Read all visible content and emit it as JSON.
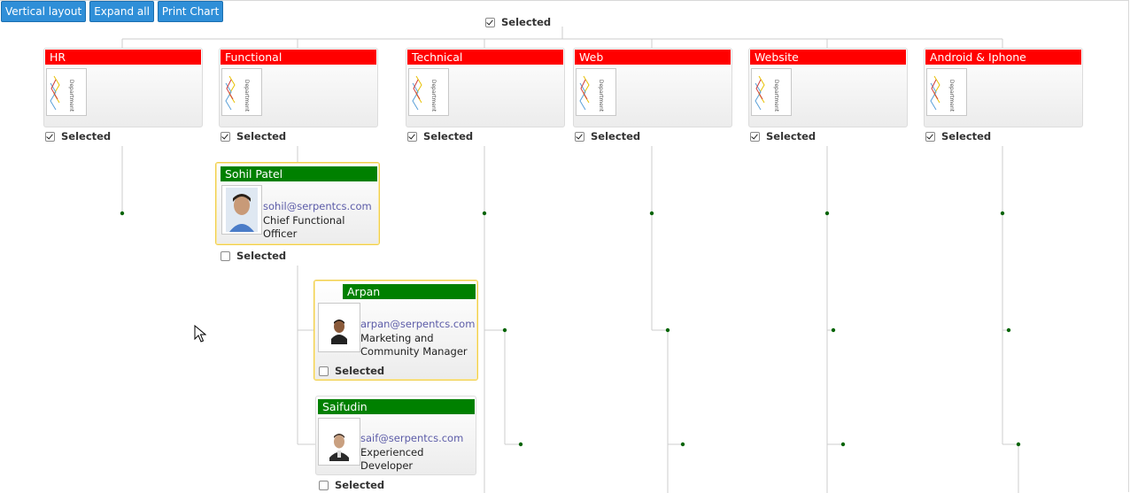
{
  "toolbar": {
    "vertical_layout_label": "Vertical layout",
    "expand_all_label": "Expand all",
    "print_chart_label": "Print Chart"
  },
  "root": {
    "selected_label": "Selected",
    "checked": true
  },
  "departments": [
    {
      "name": "HR",
      "image_text": "Department",
      "selected_label": "Selected",
      "checked": true
    },
    {
      "name": "Functional",
      "image_text": "Department",
      "selected_label": "Selected",
      "checked": true
    },
    {
      "name": "Technical",
      "image_text": "Department",
      "selected_label": "Selected",
      "checked": true
    },
    {
      "name": "Web",
      "image_text": "Department",
      "selected_label": "Selected",
      "checked": true
    },
    {
      "name": "Website",
      "image_text": "Department",
      "selected_label": "Selected",
      "checked": true
    },
    {
      "name": "Android & Iphone",
      "image_text": "Department",
      "selected_label": "Selected",
      "checked": true
    }
  ],
  "employees": {
    "sohil": {
      "name": "Sohil Patel",
      "email": "sohil@serpentcs.com",
      "job": "Chief Functional Officer",
      "selected_label": "Selected",
      "checked": false
    },
    "arpan": {
      "name": "Arpan",
      "email": "arpan@serpentcs.com",
      "job": "Marketing and Community Manager",
      "selected_label": "Selected",
      "checked": false
    },
    "saifudin": {
      "name": "Saifudin",
      "email": "saif@serpentcs.com",
      "job": "Experienced Developer",
      "selected_label": "Selected",
      "checked": false
    }
  },
  "colors": {
    "department_header": "#ff0000",
    "employee_header": "#008000",
    "connector": "#cccccc",
    "dot": "#006400",
    "button": "#2f8fd8"
  }
}
